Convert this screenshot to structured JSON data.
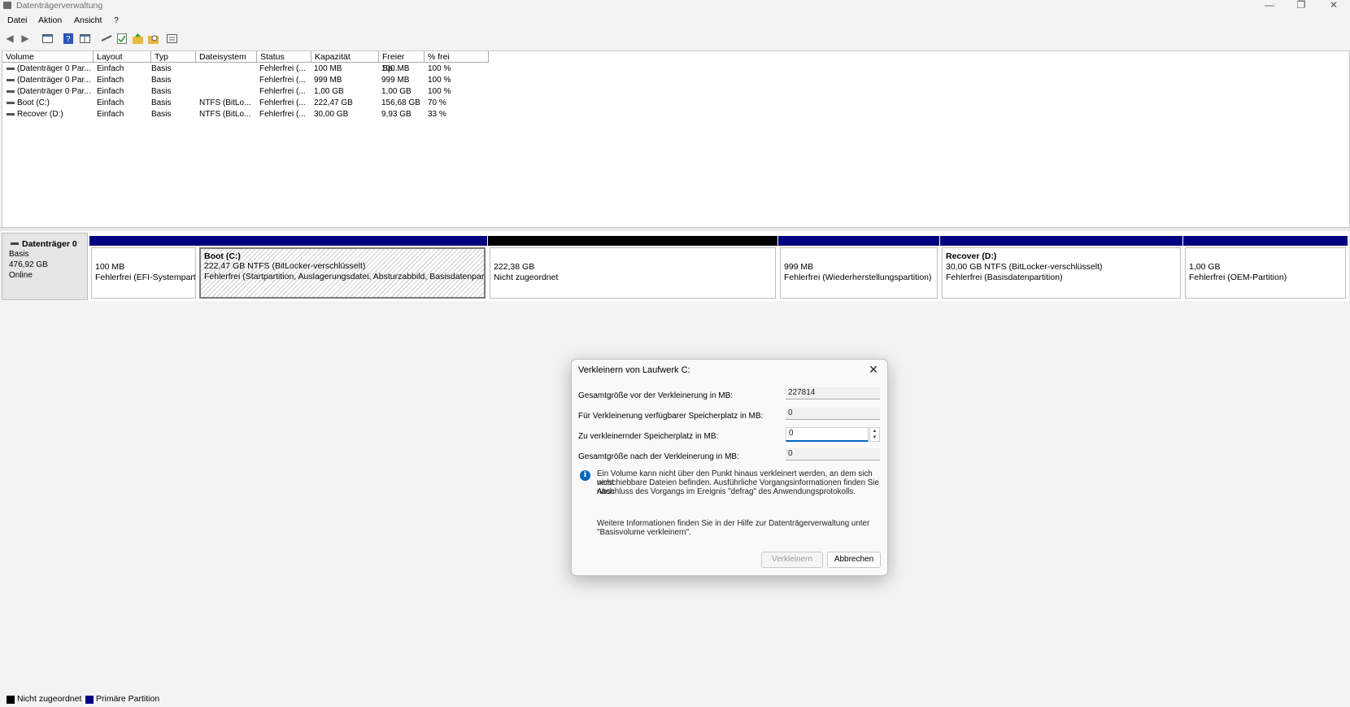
{
  "window": {
    "title": "Datenträgerverwaltung",
    "controls": [
      "—",
      "❐",
      "✕"
    ]
  },
  "menu": [
    "Datei",
    "Aktion",
    "Ansicht",
    "?"
  ],
  "columns": [
    "Volume",
    "Layout",
    "Typ",
    "Dateisystem",
    "Status",
    "Kapazität",
    "Freier Sp...",
    "% frei"
  ],
  "volumes": [
    [
      "(Datenträger 0 Par...",
      "Einfach",
      "Basis",
      "",
      "Fehlerfrei (...",
      "100 MB",
      "100 MB",
      "100 %"
    ],
    [
      "(Datenträger 0 Par...",
      "Einfach",
      "Basis",
      "",
      "Fehlerfrei (...",
      "999 MB",
      "999 MB",
      "100 %"
    ],
    [
      "(Datenträger 0 Par...",
      "Einfach",
      "Basis",
      "",
      "Fehlerfrei (...",
      "1,00 GB",
      "1,00 GB",
      "100 %"
    ],
    [
      "Boot (C:)",
      "Einfach",
      "Basis",
      "NTFS (BitLo...",
      "Fehlerfrei (...",
      "222,47 GB",
      "156,68 GB",
      "70 %"
    ],
    [
      "Recover (D:)",
      "Einfach",
      "Basis",
      "NTFS (BitLo...",
      "Fehlerfrei (...",
      "30,00 GB",
      "9,93 GB",
      "33 %"
    ]
  ],
  "disk": {
    "name": "Datenträger 0",
    "type": "Basis",
    "size": "476,92 GB",
    "state": "Online"
  },
  "partitions": [
    {
      "title": "",
      "line1": "100 MB",
      "line2": "Fehlerfrei (EFI-Systemparti"
    },
    {
      "title": "Boot  (C:)",
      "line1": "222,47 GB NTFS (BitLocker-verschlüsselt)",
      "line2": "Fehlerfrei (Startpartition, Auslagerungsdatei, Absturzabbild, Basisdatenpartit"
    },
    {
      "title": "",
      "line1": "222,38 GB",
      "line2": "Nicht zugeordnet"
    },
    {
      "title": "",
      "line1": "999 MB",
      "line2": "Fehlerfrei (Wiederherstellungspartition)"
    },
    {
      "title": "Recover  (D:)",
      "line1": "30,00 GB NTFS (BitLocker-verschlüsselt)",
      "line2": "Fehlerfrei (Basisdatenpartition)"
    },
    {
      "title": "",
      "line1": "1,00 GB",
      "line2": "Fehlerfrei (OEM-Partition)"
    }
  ],
  "legend": {
    "unallocated": "Nicht zugeordnet",
    "primary": "Primäre Partition"
  },
  "colors": {
    "primary": "#000080",
    "unallocated": "#000000",
    "accent": "#0067c0"
  },
  "dialog": {
    "title": "Verkleinern von Laufwerk C:",
    "label_total_before": "Gesamtgröße vor der Verkleinerung in MB:",
    "value_total_before": "227814",
    "label_available": "Für Verkleinerung verfügbarer Speicherplatz in MB:",
    "value_available": "0",
    "label_shrink": "Zu verkleinernder Speicherplatz in MB:",
    "value_shrink": "0",
    "label_total_after": "Gesamtgröße nach der Verkleinerung in MB:",
    "value_total_after": "0",
    "info_line1": "Ein Volume kann nicht über den Punkt hinaus verkleinert werden, an dem sich nicht",
    "info_line2": "verschiebbare Dateien befinden. Ausführliche Vorgangsinformationen finden Sie nach",
    "info_line3": "Abschluss des Vorgangs im Ereignis \"defrag\" des Anwendungsprotokolls.",
    "help_line1": "Weitere Informationen finden Sie in der Hilfe zur Datenträgerverwaltung unter",
    "help_line2": "\"Basisvolume verkleinern\".",
    "shrink_button": "Verkleinern",
    "cancel_button": "Abbrechen"
  }
}
